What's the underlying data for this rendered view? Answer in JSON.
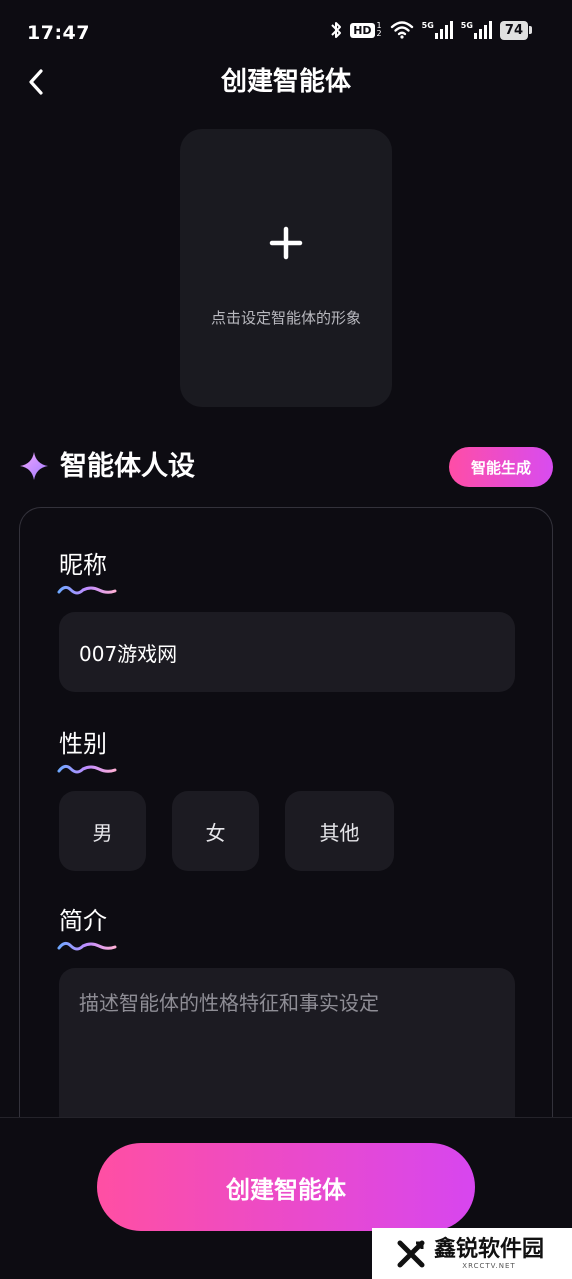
{
  "status_bar": {
    "time": "17:47",
    "hd_label": "HD",
    "hd_sub_top": "1",
    "hd_sub_bottom": "2",
    "net1_label": "5G",
    "net2_label": "5G",
    "battery": "74",
    "icons": [
      "bluetooth-icon",
      "hd-voice-icon",
      "wifi-icon",
      "signal-5g-icon",
      "signal-5g-icon",
      "battery-icon"
    ]
  },
  "header": {
    "title": "创建智能体",
    "back_icon": "chevron-left-icon"
  },
  "avatar": {
    "hint": "点击设定智能体的形象",
    "icon": "plus-icon"
  },
  "persona_section": {
    "title": "智能体人设",
    "icon": "sparkle-icon",
    "ai_generate_label": "智能生成"
  },
  "form": {
    "nickname_label": "昵称",
    "nickname_value": "007游戏网",
    "gender_label": "性别",
    "gender_options": [
      "男",
      "女",
      "其他"
    ],
    "intro_label": "简介",
    "intro_placeholder": "描述智能体的性格特征和事实设定"
  },
  "bottom": {
    "create_label": "创建智能体"
  },
  "watermark": {
    "name": "鑫锐软件园",
    "url": "XRCCTV.NET"
  },
  "colors": {
    "background": "#0d0c12",
    "card": "#1c1b22",
    "accent_start": "#ff4fa3",
    "accent_end": "#d746ef"
  }
}
